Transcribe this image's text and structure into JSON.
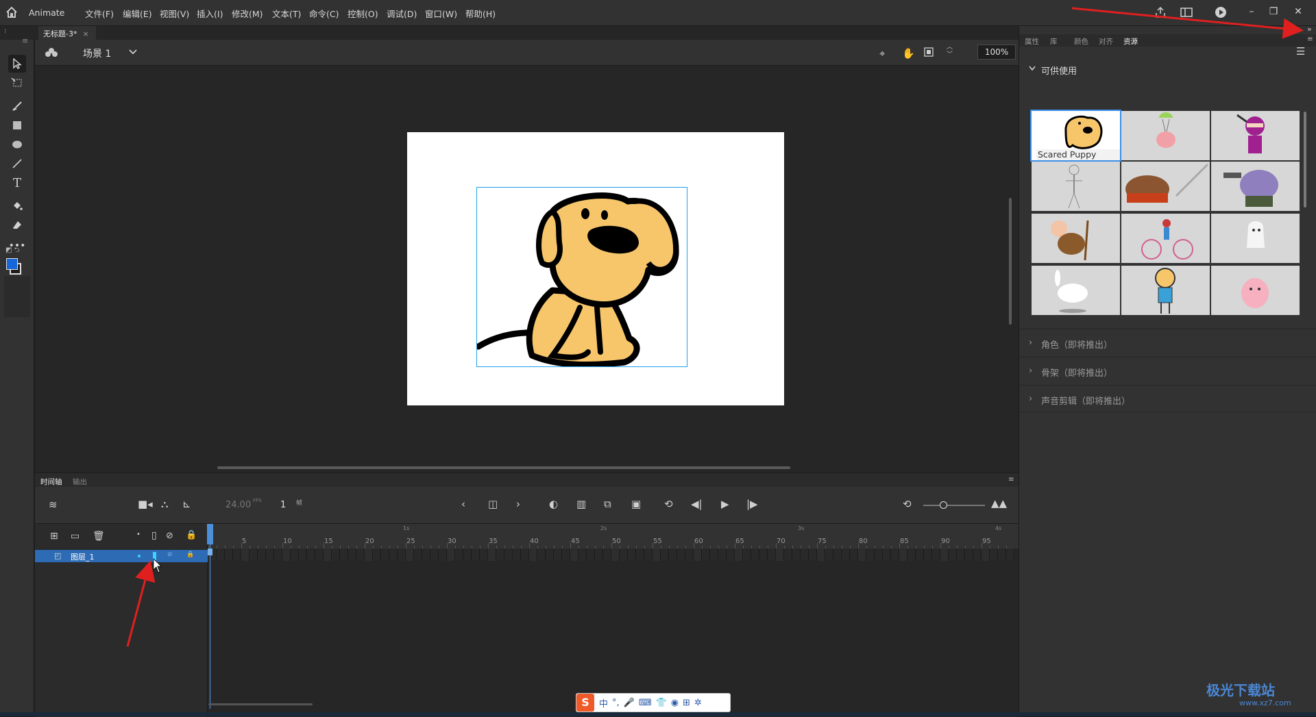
{
  "app": {
    "name": "Animate",
    "menu": [
      "文件(F)",
      "编辑(E)",
      "视图(V)",
      "插入(I)",
      "修改(M)",
      "文本(T)",
      "命令(C)",
      "控制(O)",
      "调试(D)",
      "窗口(W)",
      "帮助(H)"
    ]
  },
  "document": {
    "tab_title": "无标题-3*",
    "tab_close": "×"
  },
  "scene": {
    "label": "场景 1",
    "zoom": "100%"
  },
  "timeline": {
    "tabs": [
      "时间轴",
      "输出"
    ],
    "fps": "24.00",
    "fps_unit": "FPS",
    "current_frame": "1",
    "frame_unit": "帧",
    "layer_name": "图层_1",
    "ruler_seconds": [
      "1s",
      "2s",
      "3s",
      "4s"
    ],
    "ruler_numbers": [
      "5",
      "10",
      "15",
      "20",
      "25",
      "30",
      "35",
      "40",
      "45",
      "50",
      "55",
      "60",
      "65",
      "70",
      "75",
      "80",
      "85",
      "90",
      "95"
    ]
  },
  "right_panel": {
    "tabs": [
      "属性",
      "库",
      "颜色",
      "对齐",
      "资源"
    ],
    "active_tab": "资源",
    "section_available": "可供使用",
    "selected_asset_label": "Scared Puppy",
    "collapsed_sections": [
      "角色（即将推出）",
      "骨架（即将推出）",
      "声音剪辑（即将推出）"
    ]
  },
  "ime": {
    "lang": "中"
  },
  "watermark": {
    "text": "极光下载站",
    "url": "www.xz7.com"
  },
  "colors": {
    "accent": "#2d6bb5",
    "selection": "#1ea1e8",
    "annotation_arrow": "#e0201f",
    "puppy_fill": "#f7c66b"
  }
}
